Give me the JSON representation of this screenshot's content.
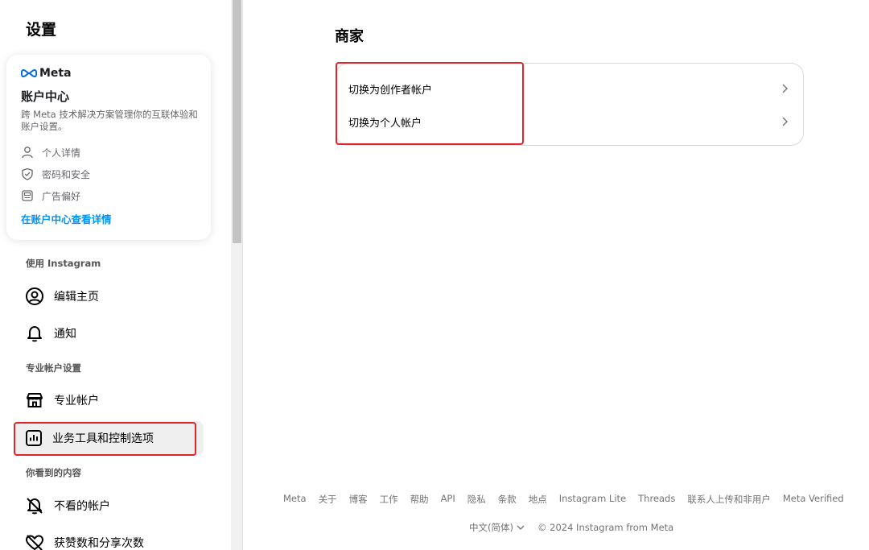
{
  "sidebar": {
    "title": "设置",
    "meta_card": {
      "logo_text": "Meta",
      "title": "账户中心",
      "description": "跨 Meta 技术解决方案管理你的互联体验和账户设置。",
      "items": [
        {
          "label": "个人详情",
          "icon": "person-icon"
        },
        {
          "label": "密码和安全",
          "icon": "shield-check-icon"
        },
        {
          "label": "广告偏好",
          "icon": "ad-preferences-icon"
        }
      ],
      "link_label": "在账户中心查看详情",
      "link_color": "#0095f6"
    },
    "sections": [
      {
        "label": "使用 Instagram",
        "items": [
          {
            "label": "编辑主页",
            "icon": "user-circle-icon"
          },
          {
            "label": "通知",
            "icon": "bell-icon"
          }
        ]
      },
      {
        "label": "专业帐户设置",
        "items": [
          {
            "label": "专业帐户",
            "icon": "storefront-icon"
          },
          {
            "label": "业务工具和控制选项",
            "icon": "bar-chart-icon",
            "active": true
          }
        ]
      },
      {
        "label": "你看到的内容",
        "items": [
          {
            "label": "不看的帐户",
            "icon": "muted-bell-icon"
          },
          {
            "label": "获赞数和分享次数",
            "icon": "heart-off-icon"
          }
        ]
      }
    ]
  },
  "main": {
    "title": "商家",
    "options": [
      {
        "label": "切换为创作者帐户",
        "icon": "chevron-right-icon"
      },
      {
        "label": "切换为个人帐户",
        "icon": "chevron-right-icon"
      }
    ]
  },
  "footer": {
    "links": [
      "Meta",
      "关于",
      "博客",
      "工作",
      "帮助",
      "API",
      "隐私",
      "条款",
      "地点",
      "Instagram Lite",
      "Threads",
      "联系人上传和非用户",
      "Meta Verified"
    ],
    "language": "中文(简体)",
    "copyright": "© 2024 Instagram from Meta"
  },
  "colors": {
    "highlight": "#e0242b",
    "link": "#0095f6",
    "active_bg": "#efefef"
  }
}
